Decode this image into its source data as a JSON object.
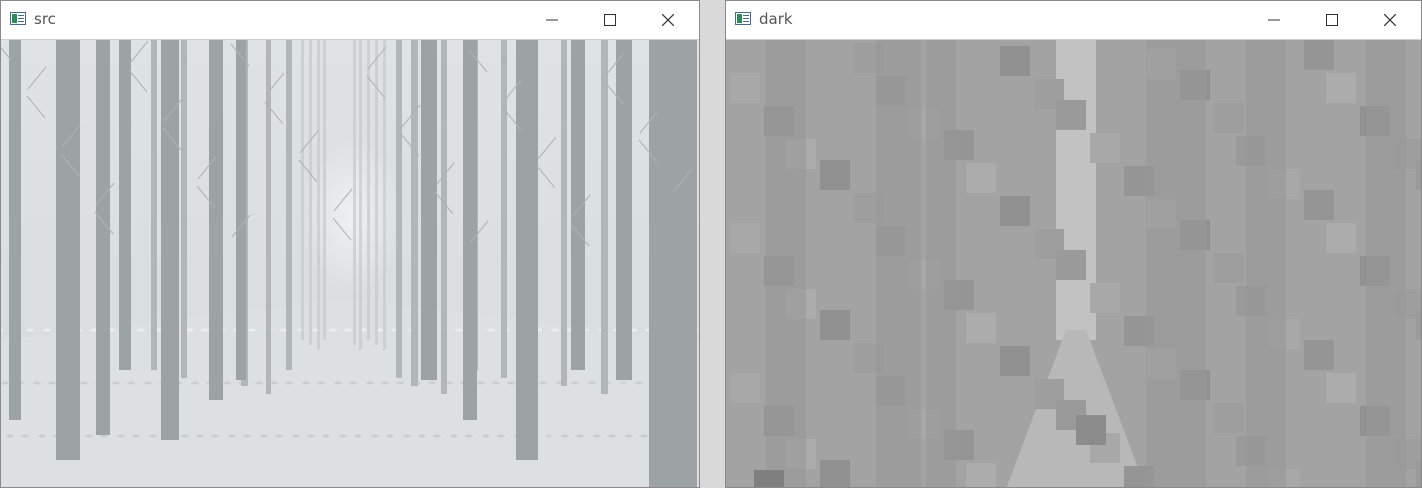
{
  "windows": [
    {
      "title": "src",
      "controls": {
        "minimize": "minimize-icon",
        "maximize": "maximize-icon",
        "close": "close-icon"
      }
    },
    {
      "title": "dark",
      "controls": {
        "minimize": "minimize-icon",
        "maximize": "maximize-icon",
        "close": "close-icon"
      }
    }
  ],
  "colors": {
    "titlebar": "#ffffff",
    "desktop": "#d9d9d9",
    "fog": "#d8dcdf",
    "dark_channel": "#a3a3a3"
  }
}
